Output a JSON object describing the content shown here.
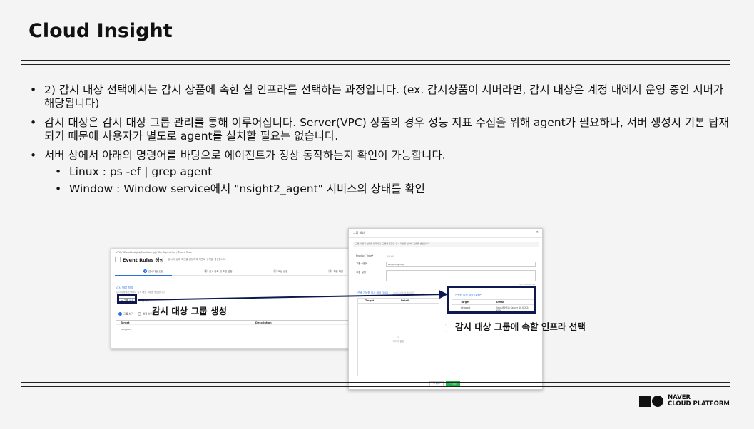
{
  "title": "Cloud Insight",
  "bullets": [
    {
      "text": "2) 감시 대상 선택에서는 감시 상품에 속한 실 인프라를 선택하는 과정입니다. (ex. 감시상품이 서버라면, 감시 대상은 계정 내에서 운영 중인 서버가 해당됩니다)"
    },
    {
      "text": "감시 대상은 감시 대상 그룹 관리를 통해 이루어집니다. Server(VPC) 상품의 경우 성능 지표 수집을 위해 agent가 필요하나, 서버 생성시 기본 탑재되기 때문에 사용자가 별도로 agent를 설치할 필요는 없습니다."
    },
    {
      "text": "서버 상에서 아래의 명령어를 바탕으로 에이전트가 정상 동작하는지 확인이 가능합니다."
    }
  ],
  "sub_bullets": [
    {
      "text": "Linux : ps -ef | grep agent"
    },
    {
      "text": "Window : Window service에서 \"nsight2_agent\" 서비스의 상태를 확인"
    }
  ],
  "left_screenshot": {
    "breadcrumb": "VPC / Cloud Insight(Monitoring) / Configuration / Event Rule",
    "back_glyph": "‹",
    "page_title": "Event Rules 생성",
    "page_desc": "감시 대상과 조건을 설정하여 이벤트 규칙을 생성합니다.",
    "steps": [
      {
        "num": "1",
        "label": "감시 대상 설정"
      },
      {
        "num": "2",
        "label": "감시 항목 및 조건 설정"
      },
      {
        "num": "3",
        "label": "액션 설정"
      },
      {
        "num": "4",
        "label": "최종 확인"
      }
    ],
    "section_title": "감시 대상 설정",
    "section_sub": "감시 대상을 선택하여 감시 대상 그룹을 생성합니다.",
    "create_group_btn": "+ 그룹 생성",
    "manage_group_link": "그룹 관리",
    "radio_options": [
      "그룹 보기",
      "항목 보기"
    ],
    "table_headers": [
      "Target",
      "Description"
    ],
    "table_rows": [
      "singport"
    ]
  },
  "right_screenshot": {
    "title": "그룹 생성",
    "close_glyph": "×",
    "info": "그룹 이름과 설명을 입력하고, 그룹에 포함할 감시 대상을 선택해 그룹을 생성합니다.",
    "fields": [
      {
        "label": "Product Type*",
        "value": "server"
      },
      {
        "label": "그룹 이름*",
        "value": "singport-group"
      },
      {
        "label": "그룹 설명",
        "value": ""
      }
    ],
    "char_count": "0 / 1000 bytes",
    "available_title": "선택 가능한 감시 대상 (0/0)",
    "search_placeholder": "감시 대상을 검색하세요",
    "search_glyph": "⌕",
    "available_headers": [
      "Target",
      "Detail"
    ],
    "empty_count": "0",
    "empty_text": "데이터 없음",
    "arrow_right": "›",
    "arrow_left": "‹",
    "selected_title": "선택한 감시 대상 (1개)*",
    "selected_headers": [
      "Target",
      "Detail"
    ],
    "selected_rows": [
      {
        "target": "singport",
        "detail": "linux(RHEL) Server 10.0.2.24 KVM"
      }
    ],
    "cancel_btn": "× 취소",
    "ok_btn": "✓ 생성"
  },
  "callouts": {
    "left": "감시 대상 그룹 생성",
    "right": "감시 대상 그룹에 속할 인프라 선택"
  },
  "logo": {
    "line1": "NAVER",
    "line2": "CLOUD PLATFORM"
  },
  "colors": {
    "highlight": "#0e1a4f",
    "accent": "#2a6ee6",
    "ok_button": "#22b34a"
  }
}
